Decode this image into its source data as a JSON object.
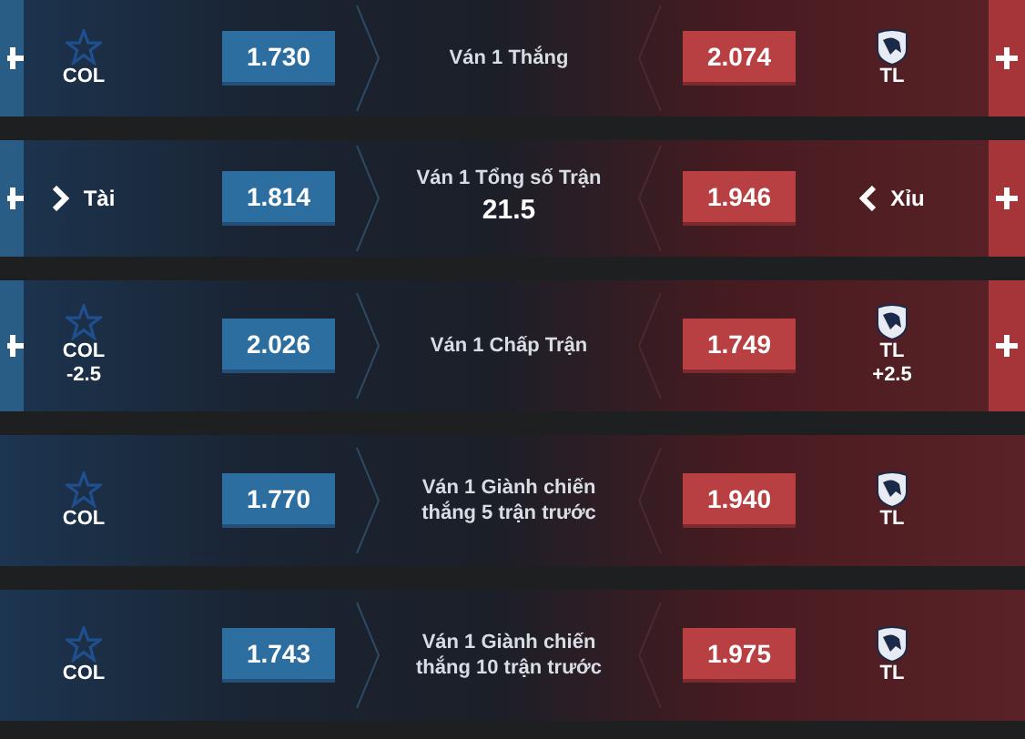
{
  "markets": [
    {
      "expandable": true,
      "title": "Ván 1 Thắng",
      "left": {
        "kind": "team",
        "name": "COL",
        "odds": "1.730"
      },
      "right": {
        "kind": "team",
        "name": "TL",
        "odds": "2.074"
      }
    },
    {
      "expandable": true,
      "title": "Ván 1 Tổng số Trận",
      "line": "21.5",
      "left": {
        "kind": "side",
        "name": "Tài",
        "odds": "1.814"
      },
      "right": {
        "kind": "side",
        "name": "Xỉu",
        "odds": "1.946"
      }
    },
    {
      "expandable": true,
      "title": "Ván 1 Chấp Trận",
      "left": {
        "kind": "team",
        "name": "COL",
        "handicap": "-2.5",
        "odds": "2.026"
      },
      "right": {
        "kind": "team",
        "name": "TL",
        "handicap": "+2.5",
        "odds": "1.749"
      }
    },
    {
      "expandable": false,
      "title": "Ván 1 Giành chiến thắng 5 trận trước",
      "left": {
        "kind": "team",
        "name": "COL",
        "odds": "1.770"
      },
      "right": {
        "kind": "team",
        "name": "TL",
        "odds": "1.940"
      }
    },
    {
      "expandable": false,
      "title": "Ván 1 Giành chiến thắng 10 trận trước",
      "left": {
        "kind": "team",
        "name": "COL",
        "odds": "1.743"
      },
      "right": {
        "kind": "team",
        "name": "TL",
        "odds": "1.975"
      }
    }
  ]
}
